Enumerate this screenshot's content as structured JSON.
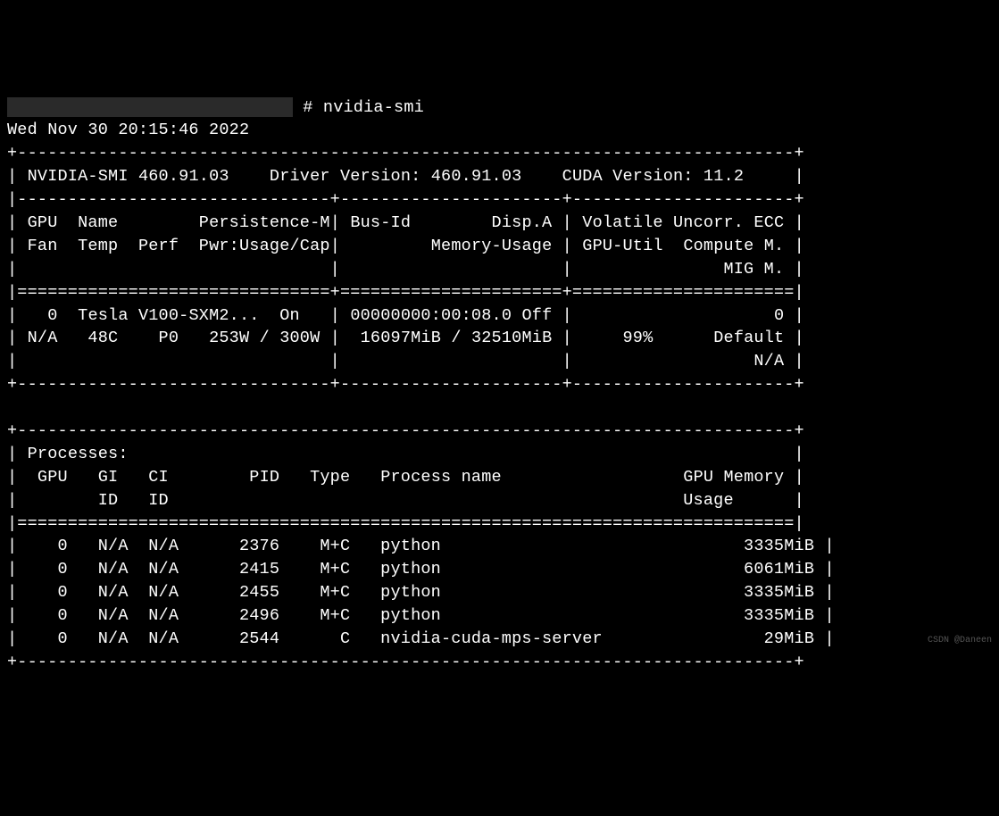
{
  "prompt": {
    "redacted_host": "",
    "separator": " # ",
    "command": "nvidia-smi"
  },
  "timestamp": "Wed Nov 30 20:15:46 2022",
  "header": {
    "smi_label": "NVIDIA-SMI",
    "smi_version": "460.91.03",
    "driver_label": "Driver Version:",
    "driver_version": "460.91.03",
    "cuda_label": "CUDA Version:",
    "cuda_version": "11.2"
  },
  "col_headers": {
    "row1_col1a": "GPU",
    "row1_col1b": "Name",
    "row1_col1c": "Persistence-M",
    "row1_col2a": "Bus-Id",
    "row1_col2b": "Disp.A",
    "row1_col3a": "Volatile Uncorr. ECC",
    "row2_col1a": "Fan",
    "row2_col1b": "Temp",
    "row2_col1c": "Perf",
    "row2_col1d": "Pwr:Usage/Cap",
    "row2_col2a": "Memory-Usage",
    "row2_col3a": "GPU-Util",
    "row2_col3b": "Compute M.",
    "row3_col3a": "MIG M."
  },
  "gpu0": {
    "id": "0",
    "name": "Tesla V100-SXM2...",
    "persistence": "On",
    "bus_id": "00000000:00:08.0",
    "disp_a": "Off",
    "ecc": "0",
    "fan": "N/A",
    "temp": "48C",
    "perf": "P0",
    "pwr_usage": "253W",
    "pwr_cap": "300W",
    "mem_used": "16097MiB",
    "mem_total": "32510MiB",
    "gpu_util": "99%",
    "compute_mode": "Default",
    "mig_mode": "N/A"
  },
  "proc_header": {
    "title": "Processes:",
    "gpu": "GPU",
    "gi": "GI",
    "ci": "CI",
    "pid": "PID",
    "type": "Type",
    "pname": "Process name",
    "mem": "GPU Memory",
    "gi_id": "ID",
    "ci_id": "ID",
    "usage": "Usage"
  },
  "processes": [
    {
      "gpu": "0",
      "gi": "N/A",
      "ci": "N/A",
      "pid": "2376",
      "type": "M+C",
      "name": "python",
      "mem": "3335MiB"
    },
    {
      "gpu": "0",
      "gi": "N/A",
      "ci": "N/A",
      "pid": "2415",
      "type": "M+C",
      "name": "python",
      "mem": "6061MiB"
    },
    {
      "gpu": "0",
      "gi": "N/A",
      "ci": "N/A",
      "pid": "2455",
      "type": "M+C",
      "name": "python",
      "mem": "3335MiB"
    },
    {
      "gpu": "0",
      "gi": "N/A",
      "ci": "N/A",
      "pid": "2496",
      "type": "M+C",
      "name": "python",
      "mem": "3335MiB"
    },
    {
      "gpu": "0",
      "gi": "N/A",
      "ci": "N/A",
      "pid": "2544",
      "type": "C",
      "name": "nvidia-cuda-mps-server",
      "mem": "29MiB"
    }
  ],
  "watermark": "CSDN @Daneen"
}
